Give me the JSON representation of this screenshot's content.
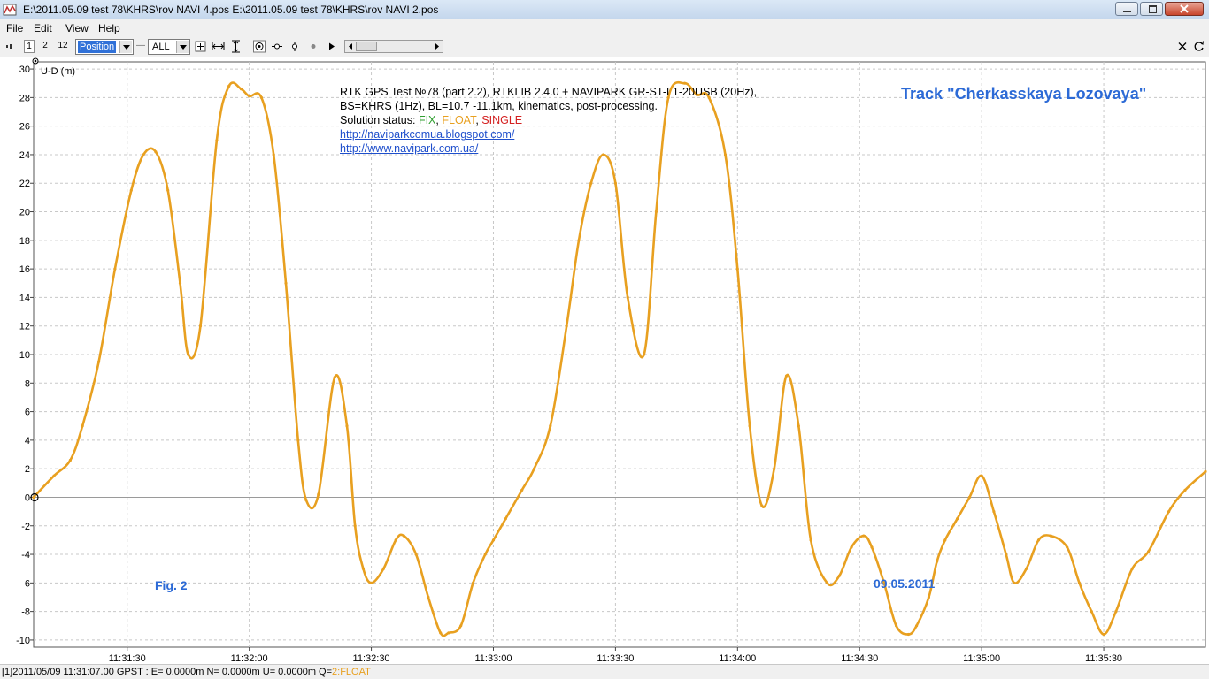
{
  "window": {
    "title": "E:\\2011.05.09 test 78\\KHRS\\rov NAVI 4.pos E:\\2011.05.09 test 78\\KHRS\\rov NAVI 2.pos"
  },
  "menu": {
    "file": "File",
    "edit": "Edit",
    "view": "View",
    "help": "Help"
  },
  "toolbar": {
    "btn1": "1",
    "btn2": "2",
    "btn12": "12",
    "plot_type": "Position",
    "sat_filter": "ALL"
  },
  "annotations": {
    "info_line1": "RTK GPS Test №78 (part 2.2), RTKLIB 2.4.0 + NAVIPARK GR-ST-L1-20USB (20Hz),",
    "info_line2": "BS=KHRS (1Hz), BL=10.7 -11.1km, kinematics, post-processing.",
    "status_prefix": "Solution status: ",
    "status_fix": "FIX",
    "status_sep1": ", ",
    "status_float": "FLOAT",
    "status_sep2": ", ",
    "status_single": "SINGLE",
    "link1": "http://naviparkcomua.blogspot.com/",
    "link2": "http://www.navipark.com.ua/",
    "track_title": "Track \"Cherkasskaya Lozovaya\"",
    "fig": "Fig. 2",
    "date": "09.05.2011"
  },
  "status": {
    "text": "[1]2011/05/09 11:31:07.00 GPST : E= 0.0000m N= 0.0000m U= 0.0000m Q=",
    "quality": "2:FLOAT"
  },
  "colors": {
    "float": "#e8a020",
    "fix": "#2e9e2e",
    "single": "#d42020",
    "annotation_blue": "#2c6ad6"
  },
  "chart_data": {
    "type": "line",
    "ylabel": "U-D (m)",
    "xlabel": "",
    "ylim": [
      -10.5,
      30.5
    ],
    "yticks": [
      30,
      28,
      26,
      24,
      22,
      20,
      18,
      16,
      14,
      12,
      10,
      8,
      6,
      4,
      2,
      0,
      -2,
      -4,
      -6,
      -8,
      -10
    ],
    "xlim": [
      "11:31:07",
      "11:35:55"
    ],
    "xticks": [
      "11:31:30",
      "11:32:00",
      "11:32:30",
      "11:33:00",
      "11:33:30",
      "11:34:00",
      "11:34:30",
      "11:35:00",
      "11:35:30"
    ],
    "grid": true,
    "series": [
      {
        "name": "FLOAT",
        "x": [
          "11:31:07",
          "11:31:12",
          "11:31:16",
          "11:31:19",
          "11:31:23",
          "11:31:27",
          "11:31:31",
          "11:31:34",
          "11:31:37",
          "11:31:40",
          "11:31:43",
          "11:31:45",
          "11:31:48",
          "11:31:52",
          "11:31:55",
          "11:31:58",
          "11:32:00",
          "11:32:03",
          "11:32:06",
          "11:32:09",
          "11:32:12",
          "11:32:14",
          "11:32:17",
          "11:32:21",
          "11:32:24",
          "11:32:26",
          "11:32:28",
          "11:32:30",
          "11:32:33",
          "11:32:36",
          "11:32:38",
          "11:32:41",
          "11:32:44",
          "11:32:47",
          "11:32:49",
          "11:32:52",
          "11:32:55",
          "11:32:58",
          "11:33:00",
          "11:33:03",
          "11:33:07",
          "11:33:10",
          "11:33:14",
          "11:33:18",
          "11:33:21",
          "11:33:24",
          "11:33:27",
          "11:33:30",
          "11:33:33",
          "11:33:37",
          "11:33:40",
          "11:33:43",
          "11:33:47",
          "11:33:50",
          "11:33:53",
          "11:33:57",
          "11:34:00",
          "11:34:03",
          "11:34:06",
          "11:34:09",
          "11:34:12",
          "11:34:15",
          "11:34:18",
          "11:34:22",
          "11:34:25",
          "11:34:28",
          "11:34:31",
          "11:34:33",
          "11:34:36",
          "11:34:39",
          "11:34:42",
          "11:34:44",
          "11:34:47",
          "11:34:49",
          "11:34:51",
          "11:34:54",
          "11:34:57",
          "11:35:00",
          "11:35:03",
          "11:35:06",
          "11:35:08",
          "11:35:11",
          "11:35:14",
          "11:35:17",
          "11:35:21",
          "11:35:24",
          "11:35:27",
          "11:35:30",
          "11:35:33",
          "11:35:37",
          "11:35:41",
          "11:35:46",
          "11:35:50",
          "11:35:55"
        ],
        "y": [
          0,
          1.5,
          2.6,
          5,
          9.5,
          16,
          21.5,
          24,
          24.2,
          21.5,
          15,
          10,
          12,
          25,
          28.8,
          28.6,
          28.1,
          28,
          24,
          15,
          4,
          -0.2,
          0.2,
          8.4,
          5,
          -2,
          -5,
          -6,
          -5,
          -3,
          -2.7,
          -4,
          -7,
          -9.5,
          -9.5,
          -9,
          -6,
          -4,
          -3,
          -1.5,
          0.5,
          2,
          5,
          12,
          18,
          22,
          24,
          22,
          14,
          10,
          20,
          28,
          29,
          28.2,
          28,
          24,
          16,
          5,
          -0.6,
          2,
          8.5,
          5,
          -3,
          -6,
          -5.5,
          -3.5,
          -2.7,
          -3.5,
          -6,
          -9,
          -9.6,
          -9,
          -7,
          -4.5,
          -3,
          -1.5,
          0,
          1.5,
          -1,
          -4,
          -6,
          -5,
          -3,
          -2.7,
          -3.5,
          -6,
          -8,
          -9.6,
          -8,
          -5,
          -3.8,
          -1,
          0.5,
          1.8
        ]
      }
    ]
  }
}
